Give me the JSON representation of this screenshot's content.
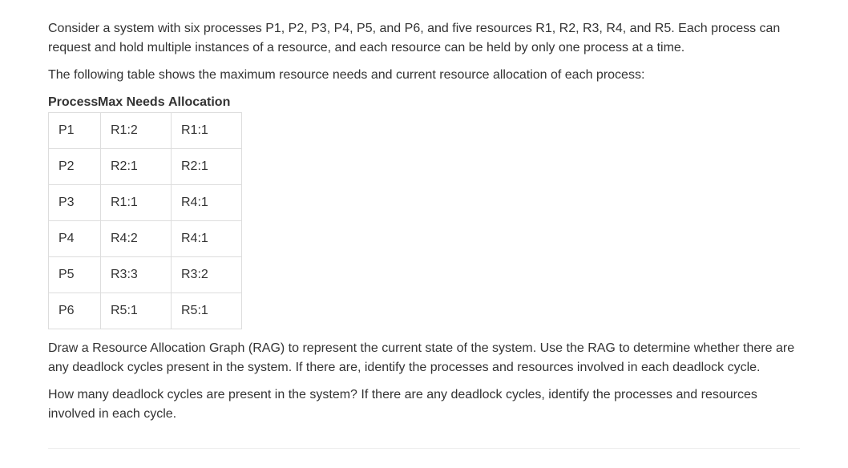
{
  "paragraphs": {
    "intro1": "Consider a system with six processes P1, P2, P3, P4, P5, and P6, and five resources R1, R2, R3, R4, and R5. Each process can request and hold multiple instances of a resource, and each resource can be held by only one process at a time.",
    "intro2": "The following table shows the maximum resource needs and current resource allocation of each process:",
    "instruction1": "Draw a Resource Allocation Graph (RAG) to represent the current state of the system. Use the RAG to determine whether there are any deadlock cycles present in the system. If there are, identify the processes and resources involved in each deadlock cycle.",
    "instruction2": "How many deadlock cycles are present in the system? If there are any deadlock cycles, identify the processes and resources involved in each cycle."
  },
  "table": {
    "headers": {
      "process": "Process",
      "maxneeds": "Max Needs",
      "allocation": "Allocation"
    },
    "rows": [
      {
        "process": "P1",
        "maxneeds": "R1:2",
        "allocation": "R1:1"
      },
      {
        "process": "P2",
        "maxneeds": "R2:1",
        "allocation": "R2:1"
      },
      {
        "process": "P3",
        "maxneeds": "R1:1",
        "allocation": "R4:1"
      },
      {
        "process": "P4",
        "maxneeds": "R4:2",
        "allocation": "R4:1"
      },
      {
        "process": "P5",
        "maxneeds": "R3:3",
        "allocation": "R3:2"
      },
      {
        "process": "P6",
        "maxneeds": "R5:1",
        "allocation": "R5:1"
      }
    ]
  }
}
